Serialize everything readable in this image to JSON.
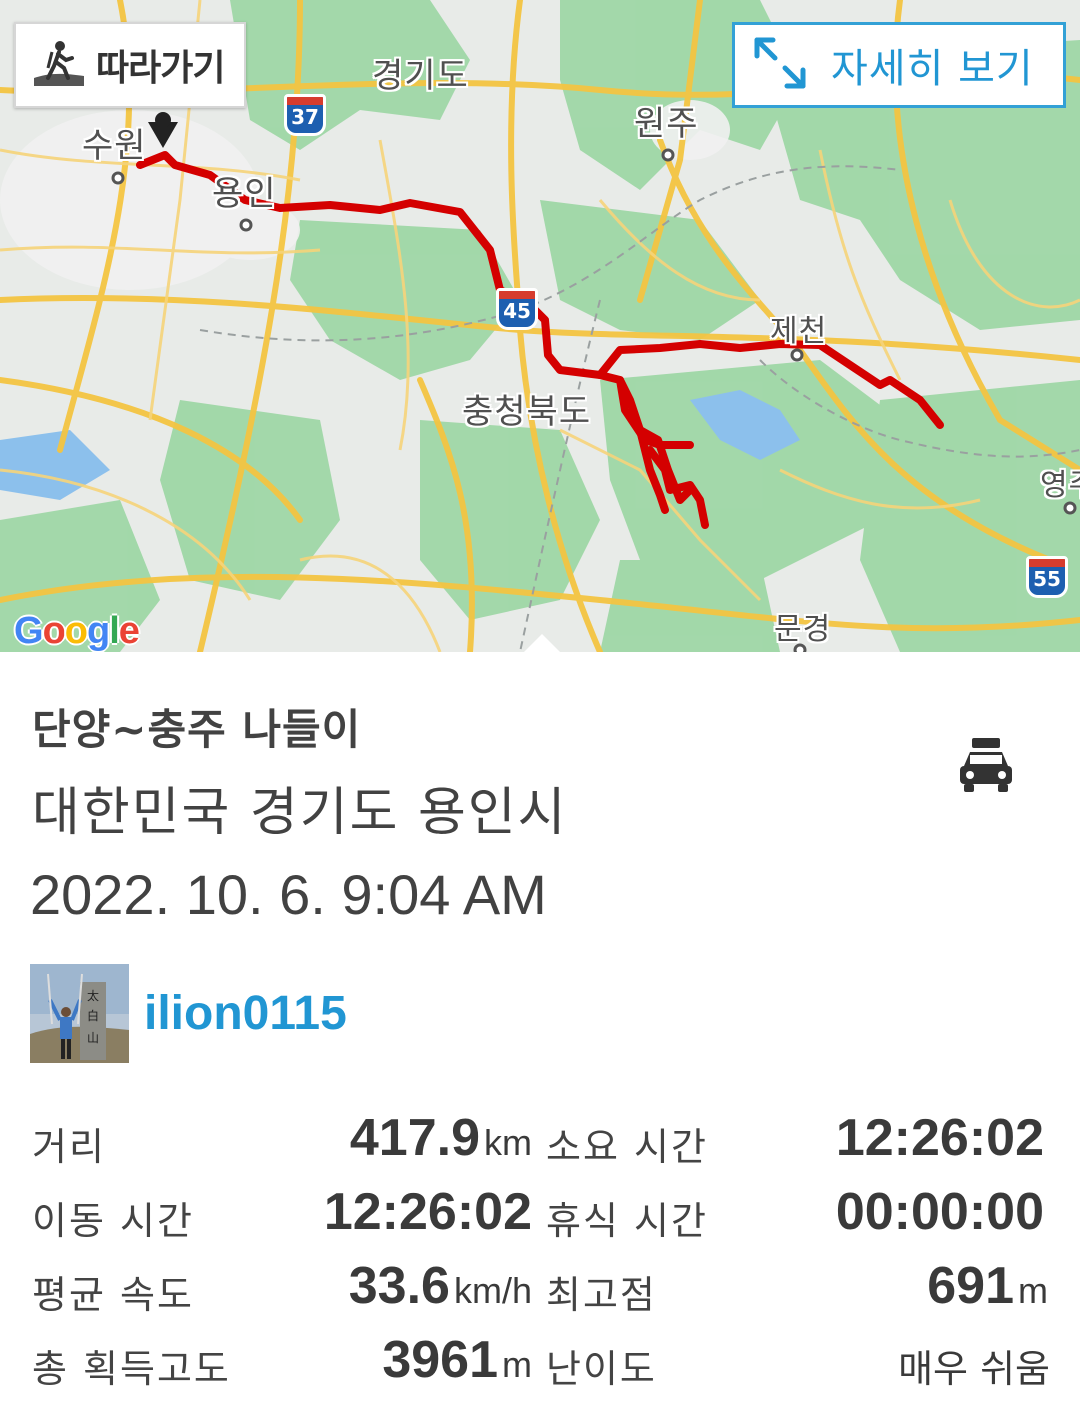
{
  "map": {
    "follow_button_label": "따라가기",
    "detail_button_label": "자세히 보기",
    "place_labels": {
      "gyeonggi": "경기도",
      "suwon": "수원",
      "yongin": "용인",
      "wonju": "원주",
      "chungbuk": "충청북도",
      "jecheon": "제천",
      "yeongju": "영주",
      "mungyeong": "문경"
    },
    "road_shields": {
      "r37": "37",
      "r45": "45",
      "r55": "55"
    },
    "attribution": "Google",
    "route_color": "#d40000"
  },
  "track": {
    "title": "단양~충주 나들이",
    "location": "대한민국 경기도 용인시",
    "datetime": "2022. 10. 6. 9:04 AM",
    "activity_icon": "car-icon",
    "username": "ilion0115"
  },
  "stats": {
    "distance_label": "거리",
    "distance_value": "417.9",
    "distance_unit": "km",
    "duration_label": "소요 시간",
    "duration_value": "12:26:02",
    "moving_time_label": "이동 시간",
    "moving_time_value": "12:26:02",
    "rest_time_label": "휴식 시간",
    "rest_time_value": "00:00:00",
    "avg_speed_label": "평균 속도",
    "avg_speed_value": "33.6",
    "avg_speed_unit": "km/h",
    "max_alt_label": "최고점",
    "max_alt_value": "691",
    "max_alt_unit": "m",
    "gain_label": "총 획득고도",
    "gain_value": "3961",
    "gain_unit": "m",
    "difficulty_label": "난이도",
    "difficulty_value": "매우 쉬움"
  }
}
